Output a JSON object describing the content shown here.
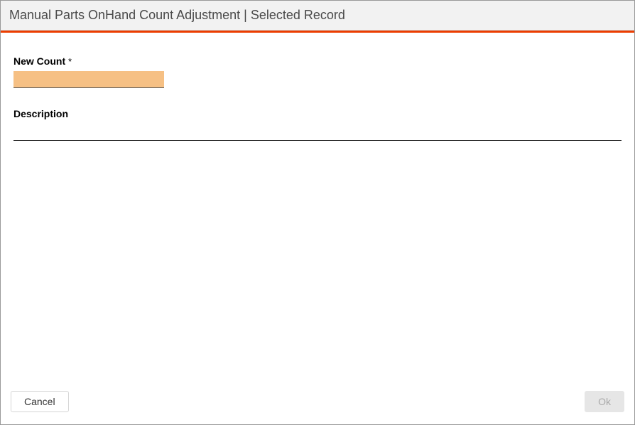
{
  "header": {
    "title": "Manual Parts OnHand Count Adjustment | Selected Record"
  },
  "form": {
    "new_count": {
      "label": "New Count",
      "required_mark": "*",
      "value": ""
    },
    "description": {
      "label": "Description",
      "value": ""
    }
  },
  "footer": {
    "cancel_label": "Cancel",
    "ok_label": "Ok"
  },
  "colors": {
    "accent": "#ec3d00",
    "highlight_field": "#f6c084"
  }
}
